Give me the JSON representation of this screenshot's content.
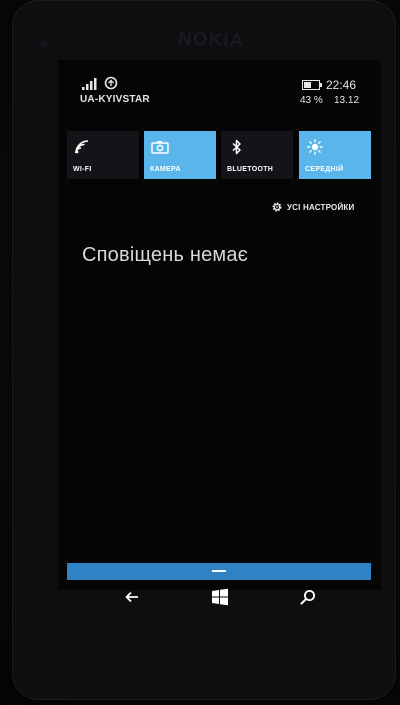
{
  "status_bar": {
    "carrier": "UA-KYIVSTAR",
    "time": "22:46",
    "battery_percent": "43 %",
    "date": "13.12",
    "icons": [
      "signal-strength-icon",
      "data-connection-icon",
      "battery-icon"
    ]
  },
  "quick_actions": [
    {
      "label": "WI-FI",
      "icon": "wifi-icon",
      "active": false
    },
    {
      "label": "КАМЕРА",
      "icon": "camera-icon",
      "active": true
    },
    {
      "label": "BLUETOOTH",
      "icon": "bluetooth-icon",
      "active": false
    },
    {
      "label": "СЕРЕДНІЙ",
      "icon": "brightness-icon",
      "active": true
    }
  ],
  "settings_link": {
    "label": "УСІ НАСТРОЙКИ",
    "icon": "gear-icon"
  },
  "notifications": {
    "empty_message": "Сповіщень немає"
  },
  "nav_bar": {
    "buttons": [
      "back-arrow-icon",
      "windows-start-icon",
      "search-icon"
    ]
  },
  "colors": {
    "accent": "#5ab5ea",
    "handle": "#2f82c4",
    "tile_off": "#141418",
    "text": "#e6e6e6"
  }
}
